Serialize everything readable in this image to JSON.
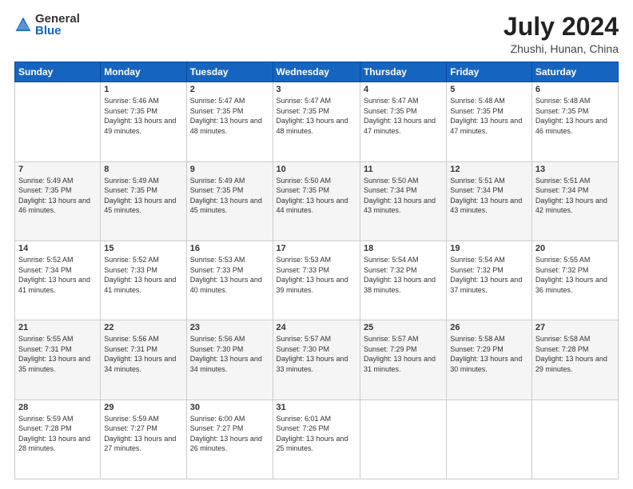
{
  "logo": {
    "text_general": "General",
    "text_blue": "Blue"
  },
  "title": {
    "month_year": "July 2024",
    "location": "Zhushi, Hunan, China"
  },
  "header_days": [
    "Sunday",
    "Monday",
    "Tuesday",
    "Wednesday",
    "Thursday",
    "Friday",
    "Saturday"
  ],
  "weeks": [
    [
      {
        "day": "",
        "sunrise": "",
        "sunset": "",
        "daylight": ""
      },
      {
        "day": "1",
        "sunrise": "Sunrise: 5:46 AM",
        "sunset": "Sunset: 7:35 PM",
        "daylight": "Daylight: 13 hours and 49 minutes."
      },
      {
        "day": "2",
        "sunrise": "Sunrise: 5:47 AM",
        "sunset": "Sunset: 7:35 PM",
        "daylight": "Daylight: 13 hours and 48 minutes."
      },
      {
        "day": "3",
        "sunrise": "Sunrise: 5:47 AM",
        "sunset": "Sunset: 7:35 PM",
        "daylight": "Daylight: 13 hours and 48 minutes."
      },
      {
        "day": "4",
        "sunrise": "Sunrise: 5:47 AM",
        "sunset": "Sunset: 7:35 PM",
        "daylight": "Daylight: 13 hours and 47 minutes."
      },
      {
        "day": "5",
        "sunrise": "Sunrise: 5:48 AM",
        "sunset": "Sunset: 7:35 PM",
        "daylight": "Daylight: 13 hours and 47 minutes."
      },
      {
        "day": "6",
        "sunrise": "Sunrise: 5:48 AM",
        "sunset": "Sunset: 7:35 PM",
        "daylight": "Daylight: 13 hours and 46 minutes."
      }
    ],
    [
      {
        "day": "7",
        "sunrise": "Sunrise: 5:49 AM",
        "sunset": "Sunset: 7:35 PM",
        "daylight": "Daylight: 13 hours and 46 minutes."
      },
      {
        "day": "8",
        "sunrise": "Sunrise: 5:49 AM",
        "sunset": "Sunset: 7:35 PM",
        "daylight": "Daylight: 13 hours and 45 minutes."
      },
      {
        "day": "9",
        "sunrise": "Sunrise: 5:49 AM",
        "sunset": "Sunset: 7:35 PM",
        "daylight": "Daylight: 13 hours and 45 minutes."
      },
      {
        "day": "10",
        "sunrise": "Sunrise: 5:50 AM",
        "sunset": "Sunset: 7:35 PM",
        "daylight": "Daylight: 13 hours and 44 minutes."
      },
      {
        "day": "11",
        "sunrise": "Sunrise: 5:50 AM",
        "sunset": "Sunset: 7:34 PM",
        "daylight": "Daylight: 13 hours and 43 minutes."
      },
      {
        "day": "12",
        "sunrise": "Sunrise: 5:51 AM",
        "sunset": "Sunset: 7:34 PM",
        "daylight": "Daylight: 13 hours and 43 minutes."
      },
      {
        "day": "13",
        "sunrise": "Sunrise: 5:51 AM",
        "sunset": "Sunset: 7:34 PM",
        "daylight": "Daylight: 13 hours and 42 minutes."
      }
    ],
    [
      {
        "day": "14",
        "sunrise": "Sunrise: 5:52 AM",
        "sunset": "Sunset: 7:34 PM",
        "daylight": "Daylight: 13 hours and 41 minutes."
      },
      {
        "day": "15",
        "sunrise": "Sunrise: 5:52 AM",
        "sunset": "Sunset: 7:33 PM",
        "daylight": "Daylight: 13 hours and 41 minutes."
      },
      {
        "day": "16",
        "sunrise": "Sunrise: 5:53 AM",
        "sunset": "Sunset: 7:33 PM",
        "daylight": "Daylight: 13 hours and 40 minutes."
      },
      {
        "day": "17",
        "sunrise": "Sunrise: 5:53 AM",
        "sunset": "Sunset: 7:33 PM",
        "daylight": "Daylight: 13 hours and 39 minutes."
      },
      {
        "day": "18",
        "sunrise": "Sunrise: 5:54 AM",
        "sunset": "Sunset: 7:32 PM",
        "daylight": "Daylight: 13 hours and 38 minutes."
      },
      {
        "day": "19",
        "sunrise": "Sunrise: 5:54 AM",
        "sunset": "Sunset: 7:32 PM",
        "daylight": "Daylight: 13 hours and 37 minutes."
      },
      {
        "day": "20",
        "sunrise": "Sunrise: 5:55 AM",
        "sunset": "Sunset: 7:32 PM",
        "daylight": "Daylight: 13 hours and 36 minutes."
      }
    ],
    [
      {
        "day": "21",
        "sunrise": "Sunrise: 5:55 AM",
        "sunset": "Sunset: 7:31 PM",
        "daylight": "Daylight: 13 hours and 35 minutes."
      },
      {
        "day": "22",
        "sunrise": "Sunrise: 5:56 AM",
        "sunset": "Sunset: 7:31 PM",
        "daylight": "Daylight: 13 hours and 34 minutes."
      },
      {
        "day": "23",
        "sunrise": "Sunrise: 5:56 AM",
        "sunset": "Sunset: 7:30 PM",
        "daylight": "Daylight: 13 hours and 34 minutes."
      },
      {
        "day": "24",
        "sunrise": "Sunrise: 5:57 AM",
        "sunset": "Sunset: 7:30 PM",
        "daylight": "Daylight: 13 hours and 33 minutes."
      },
      {
        "day": "25",
        "sunrise": "Sunrise: 5:57 AM",
        "sunset": "Sunset: 7:29 PM",
        "daylight": "Daylight: 13 hours and 31 minutes."
      },
      {
        "day": "26",
        "sunrise": "Sunrise: 5:58 AM",
        "sunset": "Sunset: 7:29 PM",
        "daylight": "Daylight: 13 hours and 30 minutes."
      },
      {
        "day": "27",
        "sunrise": "Sunrise: 5:58 AM",
        "sunset": "Sunset: 7:28 PM",
        "daylight": "Daylight: 13 hours and 29 minutes."
      }
    ],
    [
      {
        "day": "28",
        "sunrise": "Sunrise: 5:59 AM",
        "sunset": "Sunset: 7:28 PM",
        "daylight": "Daylight: 13 hours and 28 minutes."
      },
      {
        "day": "29",
        "sunrise": "Sunrise: 5:59 AM",
        "sunset": "Sunset: 7:27 PM",
        "daylight": "Daylight: 13 hours and 27 minutes."
      },
      {
        "day": "30",
        "sunrise": "Sunrise: 6:00 AM",
        "sunset": "Sunset: 7:27 PM",
        "daylight": "Daylight: 13 hours and 26 minutes."
      },
      {
        "day": "31",
        "sunrise": "Sunrise: 6:01 AM",
        "sunset": "Sunset: 7:26 PM",
        "daylight": "Daylight: 13 hours and 25 minutes."
      },
      {
        "day": "",
        "sunrise": "",
        "sunset": "",
        "daylight": ""
      },
      {
        "day": "",
        "sunrise": "",
        "sunset": "",
        "daylight": ""
      },
      {
        "day": "",
        "sunrise": "",
        "sunset": "",
        "daylight": ""
      }
    ]
  ]
}
